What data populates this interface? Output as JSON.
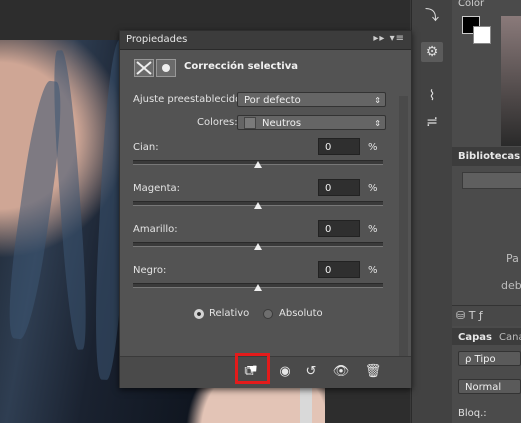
{
  "props": {
    "tab_title": "Propiedades",
    "menu_glyph": "▸▸ ▾≡",
    "adjustment_title": "Corrección selectiva",
    "preset_label": "Ajuste preestablecido:",
    "preset_value": "Por defecto",
    "colors_label": "Colores:",
    "colors_value": "Neutros",
    "sliders": [
      {
        "label": "Cian:",
        "value": "0",
        "unit": "%"
      },
      {
        "label": "Magenta:",
        "value": "0",
        "unit": "%"
      },
      {
        "label": "Amarillo:",
        "value": "0",
        "unit": "%"
      },
      {
        "label": "Negro:",
        "value": "0",
        "unit": "%"
      }
    ],
    "radio_relative": "Relativo",
    "radio_absolute": "Absoluto",
    "relative_selected": true
  },
  "right_panels": {
    "color_tab": "Color",
    "libraries_tab": "Bibliotecas",
    "lib_text_1": "Pa",
    "lib_text_2": "deb",
    "layers_tab": "Capas",
    "channels_tab": "Cana",
    "kind_filter": "ρ Tipo",
    "blend_mode": "Normal",
    "lock_label": "Bloq.:"
  },
  "colors": {
    "highlight": "#e31b1b",
    "panel_bg": "#535353"
  }
}
